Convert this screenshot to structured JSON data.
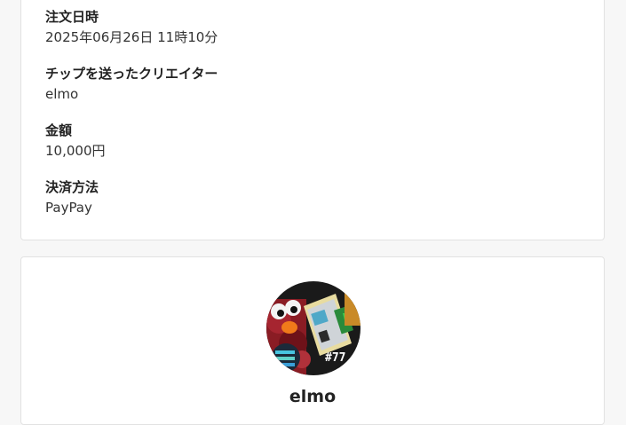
{
  "order": {
    "date_label": "注文日時",
    "date_value": "2025年06月26日 11時10分",
    "creator_label": "チップを送ったクリエイター",
    "creator_value": "elmo",
    "amount_label": "金額",
    "amount_value": "10,000円",
    "payment_label": "決済方法",
    "payment_value": "PayPay"
  },
  "creator": {
    "name": "elmo",
    "avatar_badge": "#77"
  }
}
